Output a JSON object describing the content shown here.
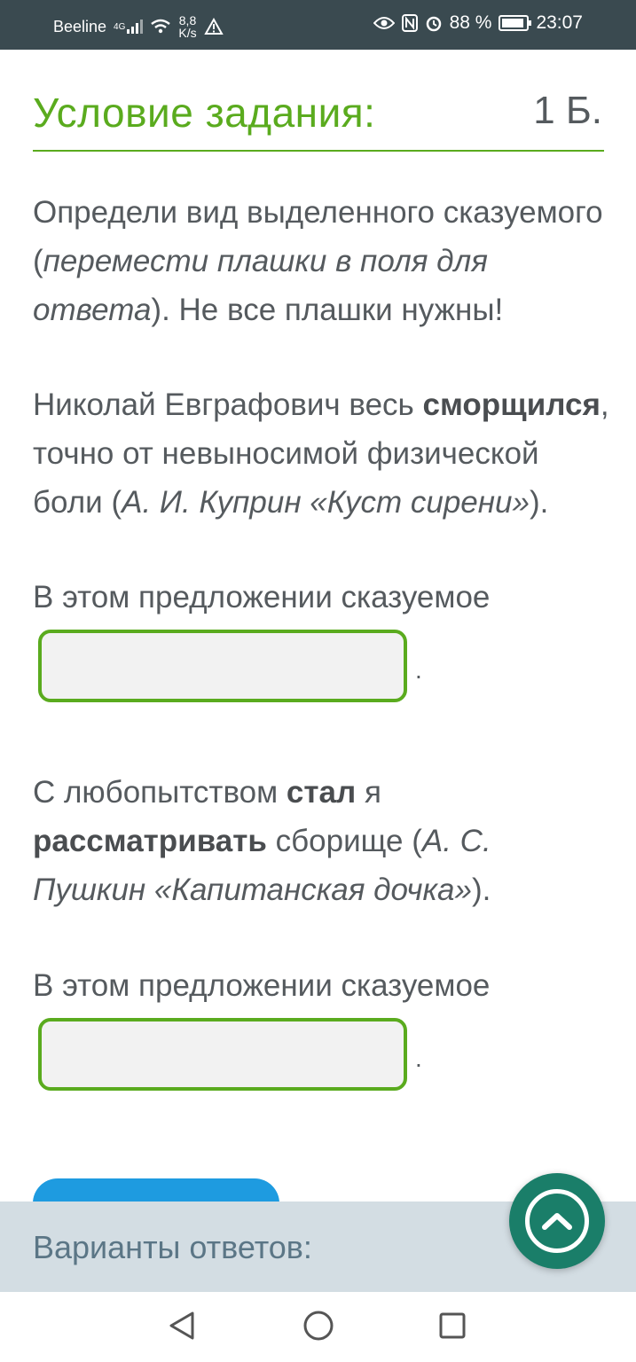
{
  "status_bar": {
    "carrier": "Beeline",
    "network": "4G",
    "speed_value": "8,8",
    "speed_unit": "K/s",
    "battery": "88 %",
    "time": "23:07",
    "icons": [
      "signal-icon",
      "wifi-icon",
      "warning-icon",
      "eye-icon",
      "nfc-icon",
      "alarm-icon",
      "battery-icon"
    ]
  },
  "task": {
    "title": "Условие задания:",
    "points": "1 Б.",
    "instruction_part1": "Определи вид выделенного сказуемого (",
    "instruction_italic": "перемести плашки в поля для ответа",
    "instruction_part2": "). Не все плашки нужны!",
    "sentence1_part1": "Николай Евграфович весь ",
    "sentence1_bold": "сморщился",
    "sentence1_part2": ", точно от невыносимой физической боли (",
    "sentence1_source": "А. И. Куприн «Куст сирени»",
    "sentence1_end": ").",
    "prompt1": "В этом предложении сказуемое",
    "dropzone1_value": "",
    "sentence2_part1": "С любопытством ",
    "sentence2_bold1": "стал",
    "sentence2_part2": " я ",
    "sentence2_bold2": "рассматривать",
    "sentence2_part3": " сборище (",
    "sentence2_source": "А. С. Пушкин «Капитанская дочка»",
    "sentence2_end": ").",
    "prompt2": "В этом предложении сказуемое",
    "dropzone2_value": "",
    "period": "."
  },
  "answers_panel": {
    "label": "Варианты ответов:"
  },
  "colors": {
    "accent_green": "#5aab1e",
    "fab_teal": "#1a7e69",
    "button_blue": "#1e9be0",
    "panel_bg": "#d3dde3"
  },
  "nav": {
    "icons": [
      "back-icon",
      "home-icon",
      "recents-icon"
    ]
  }
}
